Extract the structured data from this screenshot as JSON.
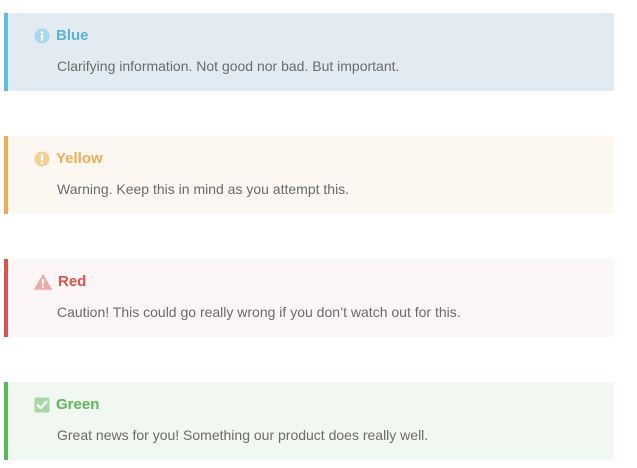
{
  "alerts": {
    "blue": {
      "icon": "info-circle-icon",
      "title": "Blue",
      "message": "Clarifying information. Not good nor bad. But important.",
      "accent": "#5bc0de",
      "background": "#e1ebf1"
    },
    "yellow": {
      "icon": "exclamation-circle-icon",
      "title": "Yellow",
      "message": "Warning. Keep this in mind as you attempt this.",
      "accent": "#f0ad4e",
      "background": "#fcf8f1"
    },
    "red": {
      "icon": "warning-triangle-icon",
      "title": "Red",
      "message": "Caution! This could go really wrong if you don’t watch out for this.",
      "accent": "#d9534f",
      "background": "#fdf6f6"
    },
    "green": {
      "icon": "checkbox-check-icon",
      "title": "Green",
      "message": "Great news for you! Something our product does really well.",
      "accent": "#5cb85c",
      "background": "#f1f7f1"
    }
  }
}
